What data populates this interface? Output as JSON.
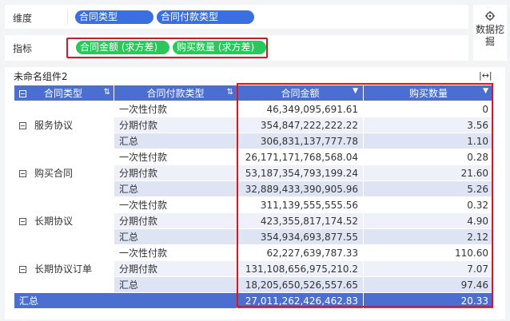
{
  "dimensions": {
    "label": "维度",
    "fields": [
      "合同类型",
      "合同付款类型"
    ]
  },
  "metrics": {
    "label": "指标",
    "fields": [
      "合同金额 (求方差)",
      "购买数量 (求方差)"
    ]
  },
  "side_tool": {
    "label": "数据挖掘",
    "icon": "settings-search-icon"
  },
  "component": {
    "title": "未命名组件2",
    "expand_icon": "expand-width-icon"
  },
  "table": {
    "headers": [
      "合同类型",
      "合同付款类型",
      "合同金额",
      "购买数量"
    ],
    "groups": [
      {
        "name": "服务协议",
        "rows": [
          {
            "type": "一次性付款",
            "amount": "46,349,095,691.61",
            "qty": "0"
          },
          {
            "type": "分期付款",
            "amount": "354,847,222,222.22",
            "qty": "3.56"
          },
          {
            "type": "汇总",
            "amount": "306,831,137,777.78",
            "qty": "1.10"
          }
        ]
      },
      {
        "name": "购买合同",
        "rows": [
          {
            "type": "一次性付款",
            "amount": "26,171,171,768,568.04",
            "qty": "0.28"
          },
          {
            "type": "分期付款",
            "amount": "53,187,354,793,199.24",
            "qty": "21.60"
          },
          {
            "type": "汇总",
            "amount": "32,889,433,390,905.96",
            "qty": "5.26"
          }
        ]
      },
      {
        "name": "长期协议",
        "rows": [
          {
            "type": "一次性付款",
            "amount": "311,139,555,555.56",
            "qty": "0.32"
          },
          {
            "type": "分期付款",
            "amount": "423,355,817,174.52",
            "qty": "4.90"
          },
          {
            "type": "汇总",
            "amount": "354,934,693,877.55",
            "qty": "2.12"
          }
        ]
      },
      {
        "name": "长期协议订单",
        "rows": [
          {
            "type": "一次性付款",
            "amount": "62,227,639,787.33",
            "qty": "110.60"
          },
          {
            "type": "分期付款",
            "amount": "131,108,656,975,210.2",
            "qty": "7.07"
          },
          {
            "type": "汇总",
            "amount": "18,205,650,526,557.65",
            "qty": "97.46"
          }
        ]
      }
    ],
    "grand_total": {
      "label": "汇总",
      "amount": "27,011,262,426,462.83",
      "qty": "20.33"
    }
  },
  "colors": {
    "header": "#4a6fd1",
    "dimension_pill": "#3b6fe0",
    "metric_pill": "#2ac75a",
    "highlight_border": "#e5121d"
  }
}
